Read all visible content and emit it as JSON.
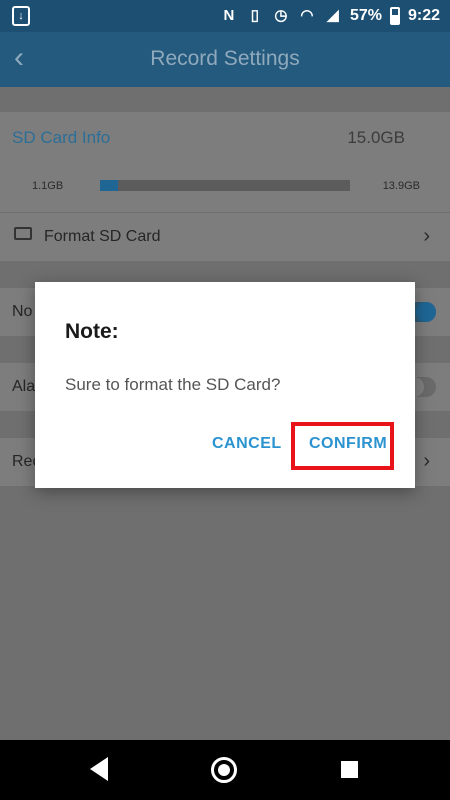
{
  "status_bar": {
    "battery_percent": "57%",
    "time": "9:22",
    "icons": [
      "screenshot-icon",
      "nfc-icon",
      "vibrate-icon",
      "alarm-icon",
      "wifi-icon",
      "signal-icon",
      "battery-icon"
    ]
  },
  "app_bar": {
    "title": "Record Settings",
    "back_icon": "back-arrow-icon"
  },
  "sd_card": {
    "title": "SD Card Info",
    "total": "15.0GB",
    "used": "1.1GB",
    "free": "13.9GB",
    "used_fraction": 0.07,
    "format_label": "Format SD Card"
  },
  "rows": {
    "row1_label": "No",
    "row2_label": "Ala",
    "row3_label": "Rec"
  },
  "dialog": {
    "title": "Note:",
    "message": "Sure to format the SD Card?",
    "cancel_label": "CANCEL",
    "confirm_label": "CONFIRM"
  },
  "colors": {
    "accent": "#2b93cf",
    "highlight": "#e81419",
    "header": "#245a7d"
  }
}
